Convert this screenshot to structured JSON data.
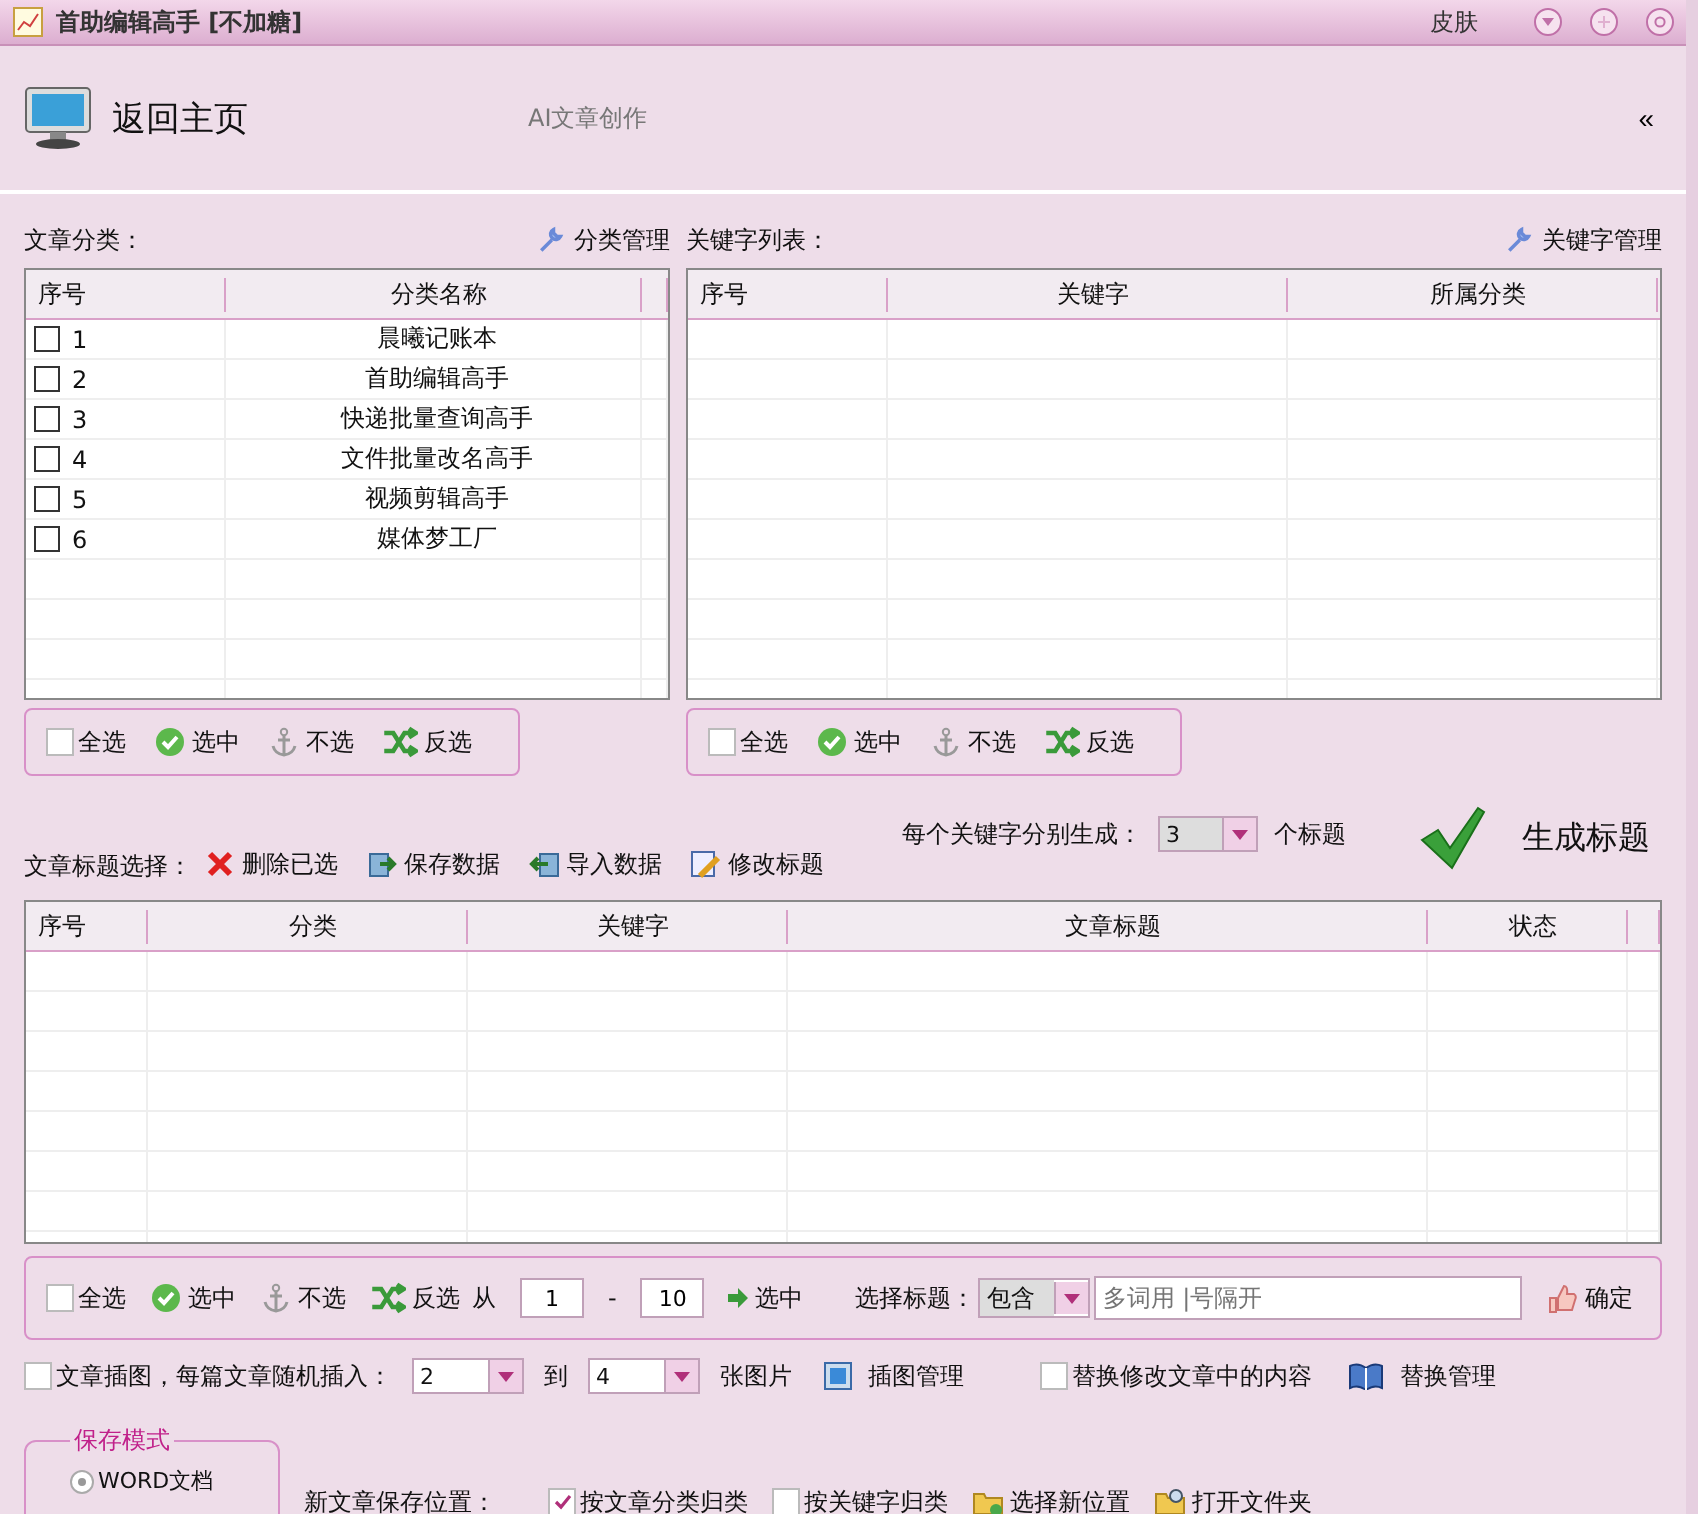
{
  "window": {
    "title": "首助编辑高手 [不加糖]",
    "skin": "皮肤"
  },
  "header": {
    "home": "返回主页",
    "subtitle": "AI文章创作",
    "collapse": "«"
  },
  "categories": {
    "label": "文章分类：",
    "manage": "分类管理",
    "columns": [
      "序号",
      "分类名称"
    ],
    "rows": [
      {
        "no": "1",
        "name": "晨曦记账本",
        "checked": false
      },
      {
        "no": "2",
        "name": "首助编辑高手",
        "checked": false
      },
      {
        "no": "3",
        "name": "快递批量查询高手",
        "checked": false
      },
      {
        "no": "4",
        "name": "文件批量改名高手",
        "checked": false
      },
      {
        "no": "5",
        "name": "视频剪辑高手",
        "checked": false
      },
      {
        "no": "6",
        "name": "媒体梦工厂",
        "checked": false
      }
    ],
    "toolbar": [
      {
        "kind": "checkbox",
        "label": "全选",
        "checked": false
      },
      {
        "kind": "check",
        "label": "选中"
      },
      {
        "kind": "anchor",
        "label": "不选"
      },
      {
        "kind": "invert",
        "label": "反选"
      }
    ]
  },
  "keywords": {
    "label": "关键字列表：",
    "manage": "关键字管理",
    "columns": [
      "序号",
      "关键字",
      "所属分类"
    ],
    "toolbar": [
      {
        "kind": "checkbox",
        "label": "全选",
        "checked": false
      },
      {
        "kind": "check",
        "label": "选中"
      },
      {
        "kind": "anchor",
        "label": "不选"
      },
      {
        "kind": "invert",
        "label": "反选"
      }
    ]
  },
  "titles": {
    "label": "文章标题选择：",
    "actions": [
      {
        "kind": "delete",
        "label": "删除已选"
      },
      {
        "kind": "save",
        "label": "保存数据"
      },
      {
        "kind": "import",
        "label": "导入数据"
      },
      {
        "kind": "edit",
        "label": "修改标题"
      }
    ],
    "per_keyword": {
      "label": "每个关键字分别生成：",
      "value": "3",
      "unit": "个标题"
    },
    "generate": "生成标题",
    "columns": [
      "序号",
      "分类",
      "关键字",
      "文章标题",
      "状态"
    ]
  },
  "selection_bar": {
    "toolbar": [
      {
        "kind": "checkbox",
        "label": "全选",
        "checked": false
      },
      {
        "kind": "check",
        "label": "选中"
      },
      {
        "kind": "anchor",
        "label": "不选"
      },
      {
        "kind": "invert",
        "label": "反选"
      }
    ],
    "from_label": "从",
    "from": "1",
    "dash": "-",
    "to": "10",
    "range_select": "选中",
    "filter_label": "选择标题：",
    "filter_mode": "包含",
    "filter_placeholder": "多词用 |号隔开",
    "confirm": "确定"
  },
  "images": {
    "label": "文章插图，每篇文章随机插入：",
    "checked": false,
    "min": "2",
    "to": "到",
    "max": "4",
    "unit": "张图片",
    "manage": "插图管理"
  },
  "replace": {
    "label": "替换修改文章中的内容",
    "checked": false,
    "manage": "替换管理"
  },
  "save_mode": {
    "legend": "保存模式",
    "options": [
      {
        "label": "WORD文档",
        "selected": true
      }
    ]
  },
  "save_location": {
    "label": "新文章保存位置：",
    "options": [
      {
        "label": "按文章分类归类",
        "checked": true
      },
      {
        "label": "按关键字归类",
        "checked": false
      }
    ],
    "actions": [
      {
        "kind": "folder-new",
        "label": "选择新位置"
      },
      {
        "kind": "folder-open",
        "label": "打开文件夹"
      }
    ]
  }
}
